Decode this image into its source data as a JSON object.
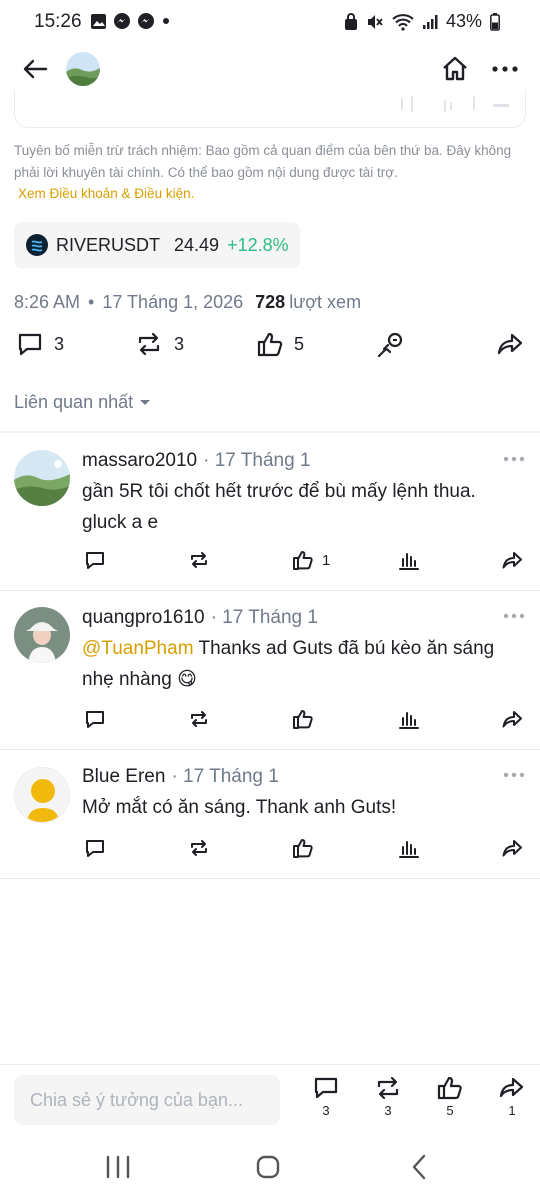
{
  "status": {
    "time": "15:26",
    "battery": "43%"
  },
  "post": {
    "disclaimer": "Tuyên bố miễn trừ trách nhiệm: Bao gồm cả quan điểm của bên thứ ba. Đây không phải lời khuyên tài chính. Có thể bao gồm nội dung được tài trợ.",
    "terms_link": "Xem Điều khoản & Điều kiện.",
    "ticker": {
      "symbol": "RIVERUSDT",
      "price": "24.49",
      "change": "+12.8%"
    },
    "meta": {
      "time": "8:26 AM",
      "separator": "•",
      "date": "17 Tháng 1, 2026",
      "views": "728",
      "views_label": "lượt xem"
    },
    "actions": {
      "comments": "3",
      "reposts": "3",
      "likes": "5"
    },
    "sort_label": "Liên quan nhất"
  },
  "comments": [
    {
      "username": "massaro2010",
      "date": "· 17 Tháng 1",
      "text": "gần 5R tôi chốt hết trước để bù mấy lệnh thua. gluck a e",
      "likes": "1"
    },
    {
      "username": "quangpro1610",
      "date": "· 17 Tháng 1",
      "mention": "@TuanPham",
      "text": " Thanks ad Guts đã bú kèo ăn sáng nhẹ nhàng 😋",
      "likes": ""
    },
    {
      "username": "Blue Eren",
      "date": "· 17 Tháng 1",
      "text": "Mở mắt có ăn sáng. Thank anh Guts!",
      "likes": ""
    }
  ],
  "bottom_bar": {
    "placeholder": "Chia sẻ ý tưởng của bạn...",
    "comments": "3",
    "reposts": "3",
    "likes": "5",
    "shares": "1"
  },
  "colors": {
    "accent": "#d89f00",
    "positive": "#2ebd85",
    "secondary_text": "#707a8a"
  }
}
